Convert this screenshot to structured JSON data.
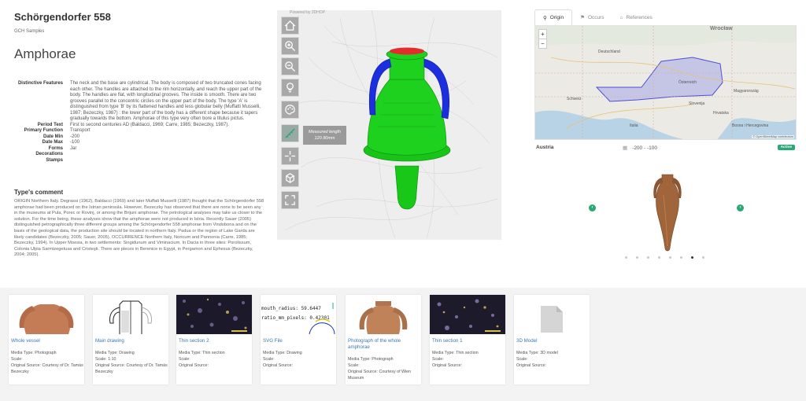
{
  "header": {
    "title": "Schörgendorfer 558",
    "subtitle": "GCH Samples",
    "type_name": "Amphorae"
  },
  "properties": [
    {
      "key": "Distinctive Features",
      "value": "The neck and the base are cylindrical. The body is composed of two truncated cones facing each other. The handles are attached to the rim horizontally, and reach the upper part of the body. The handles are flat, with longitudinal grooves. The inside is smooth. There are two grooves parallel to the concentric circles on the upper part of the body. The type 'A' is distinguished from type 'B' by its flattened handles and less globular belly (Muffatti Musselli, 1987; Bezeczky, 1987) : the lower part of the body has a different shape because it tapers gradually towards the bottom. Amphorae of this type very often bore a titulus pictus."
    },
    {
      "key": "Period Text",
      "value": "First to second centuries AD (Baldacci, 1969; Carre, 1985; Bezeczky, 1987)."
    },
    {
      "key": "Primary Function",
      "value": "Transport"
    },
    {
      "key": "Date Min",
      "value": "-200"
    },
    {
      "key": "Date Max",
      "value": "-100"
    },
    {
      "key": "Forms",
      "value": "Jar"
    },
    {
      "key": "Decorations",
      "value": ""
    },
    {
      "key": "Stamps",
      "value": ""
    }
  ],
  "comment": {
    "title": "Type's comment",
    "text": "ORIGIN Northern Italy. Degrassi (1962), Baldacci (1969) and later Muffati Musselli (1987) thought that the Schörgendorfer 558 amphorae had been produced on the Istrian peninsula. However, Bezeczky has observed that there are none to be seen any in the museums at Pula, Porec or Rovinj, or among the Brijuni amphorae. The petrological analyses may take us closer to the solution. For the time being, these analyses show that the amphorae were not produced in Istria. Recently Sauer (2005) distinguished petrographically three different groups among the Schörgendorfer 558 amphorae from Vindobona and on the basis of the geological data, the production site should be located in northern Italy. Padua or the region of Lake Garda are likely candidates (Bezeczky, 2005; Sauer, 2005). OCCURRENCE Northern Italy, Noricum and Pannonia (Carre, 1985; Bezeczky, 1994). In Upper Moesia, in two settlements: Singidunum and Viminacium. In Dacia in three sites: Porolissum, Colonia Ulpia Sarmizegetusa and Cristeşti. There are pieces in Berenice in Egypt, in Pergamon and Ephesus (Bezeczky, 2004; 2005)."
  },
  "viewer": {
    "caption": "Powered by 3DHOP",
    "measure_label": "Measured length",
    "measure_value": "120.90mm",
    "tools": [
      "home-icon",
      "zoom-in-icon",
      "zoom-out-icon",
      "light-icon",
      "color-icon",
      "measure-icon",
      "pick-point-icon",
      "section-icon",
      "fullscreen-icon"
    ]
  },
  "tabs": [
    {
      "label": "Origin",
      "icon": "map-pin-icon",
      "active": true
    },
    {
      "label": "Occurs",
      "icon": "pin-icon",
      "active": false
    },
    {
      "label": "References",
      "icon": "tag-icon",
      "active": false
    }
  ],
  "map": {
    "labels": [
      "Wrocław",
      "Österreich",
      "Magyarország",
      "Hrvatska",
      "Bosna i Hercegovina",
      "Italia",
      "Slovenija",
      "Schweiz",
      "Deutschland"
    ],
    "attribution": "© OpenStreetMap contributors",
    "zoom_in": "+",
    "zoom_out": "−"
  },
  "origin": {
    "region": "Austria",
    "date_range": "-200 - -100",
    "status": "Active"
  },
  "carousel": {
    "prev": "‹",
    "next": "›",
    "dots": 8,
    "active_dot": 6
  },
  "media": [
    {
      "title": "Whole vessel",
      "lines": [
        "Media Type: Photograph",
        "Scale:",
        "Original Source: Courtesy of Dr. Tamás Bezeczky"
      ]
    },
    {
      "title": "Main drawing",
      "lines": [
        "Media Type: Drawing",
        "Scale: 1:10",
        "Original Source: Courtesy of Dr. Tamás Bezeczky"
      ]
    },
    {
      "title": "Thin section 2",
      "lines": [
        "Media Type: Thin section",
        "Scale:",
        "Original Source:"
      ]
    },
    {
      "title": "SVG File",
      "lines": [
        "Media Type: Drawing",
        "Scale:",
        "Original Source:"
      ],
      "thumb_lines": [
        "mouth_radius: 59.6447",
        "ratio_mm_pixels: 0.42301"
      ]
    },
    {
      "title": "Photograph of the whole amphorae",
      "lines": [
        "Media Type: Photograph",
        "Scale:",
        "Original Source: Courtesy of Wien Museum"
      ]
    },
    {
      "title": "Thin section 1",
      "lines": [
        "Media Type: Thin section",
        "Scale:",
        "Original Source:"
      ]
    },
    {
      "title": "3D Model",
      "lines": [
        "Media Type: 3D model",
        "Scale:",
        "Original Source:"
      ]
    }
  ]
}
